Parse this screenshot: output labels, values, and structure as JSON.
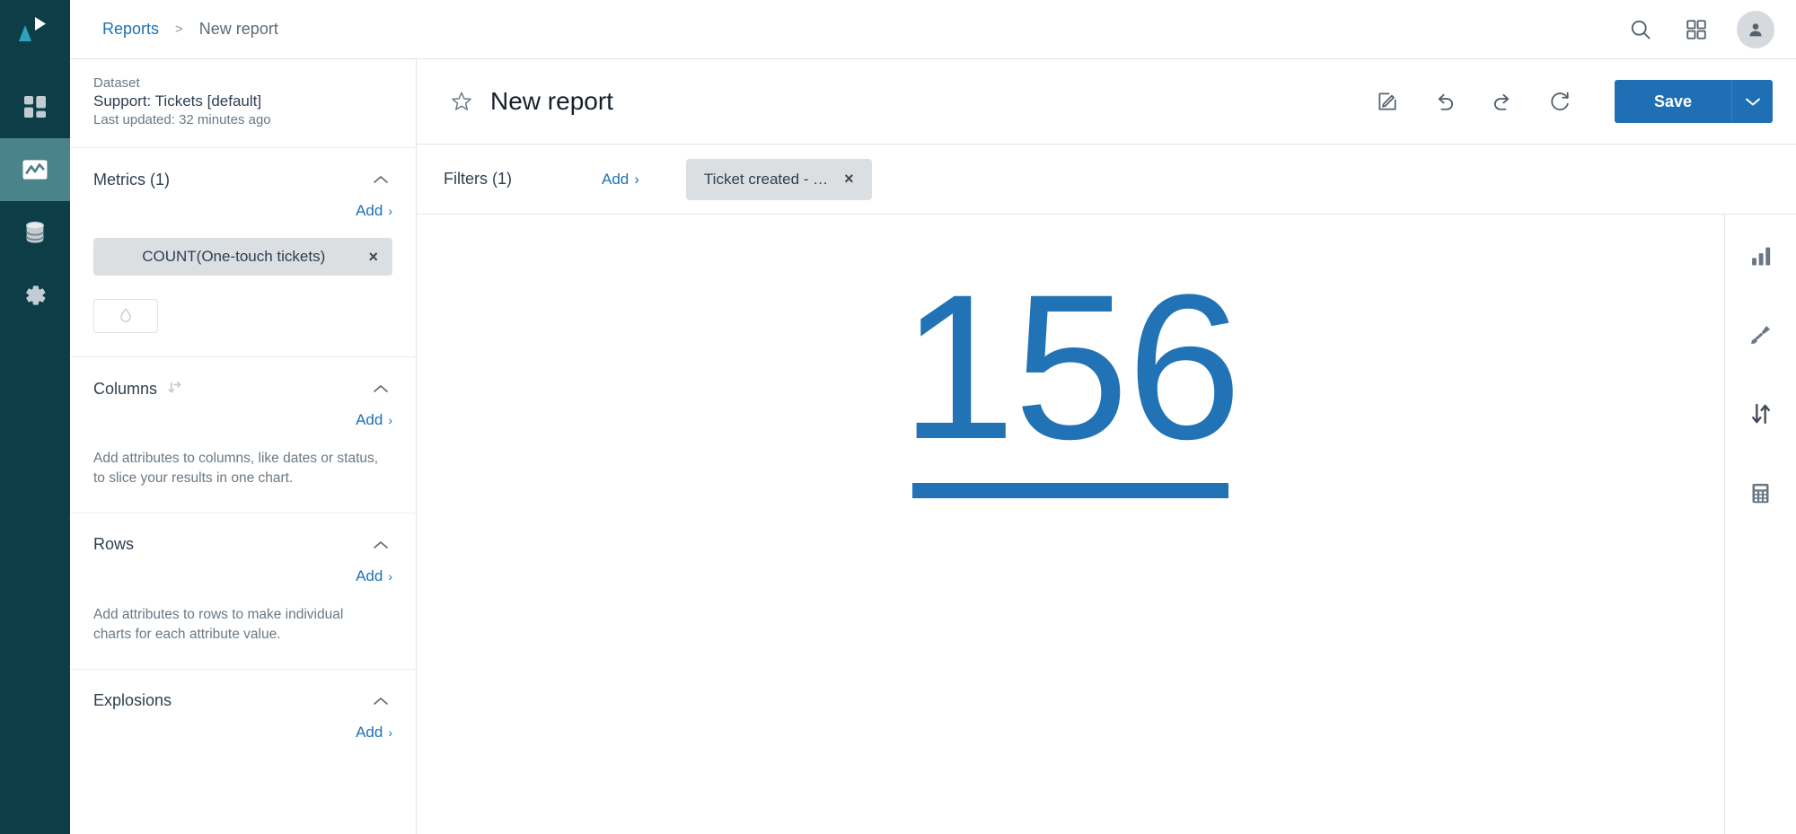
{
  "app": {
    "logo_name": "play-triangle-logo",
    "accent_blue": "#1f6fb5",
    "kpi_blue": "#2273b5",
    "rail_bg": "#0d3e47",
    "rail_active_bg": "#4a8389",
    "chip_bg": "#dcdfe2"
  },
  "rail": {
    "items": [
      {
        "icon": "dashboard-grid-icon",
        "name": "sidebar-item-dashboards",
        "active": false
      },
      {
        "icon": "line-chart-icon",
        "name": "sidebar-item-reports",
        "active": true
      },
      {
        "icon": "database-icon",
        "name": "sidebar-item-datasets",
        "active": false
      },
      {
        "icon": "gear-icon",
        "name": "sidebar-item-settings",
        "active": false
      }
    ]
  },
  "topbar": {
    "breadcrumb": {
      "root": "Reports",
      "separator": ">",
      "current": "New report"
    },
    "actions": [
      {
        "name": "search-icon",
        "label": "Search"
      },
      {
        "name": "apps-grid-icon",
        "label": "Apps"
      },
      {
        "name": "avatar",
        "label": "Account"
      }
    ]
  },
  "panel": {
    "dataset": {
      "label": "Dataset",
      "name": "Support: Tickets [default]",
      "updated": "Last updated: 32 minutes ago"
    },
    "sections": [
      {
        "key": "metrics",
        "title": "Metrics (1)",
        "add_label": "Add",
        "add_caret": "›",
        "chip": "COUNT(One-touch tickets)",
        "chip_close": "×",
        "hint": ""
      },
      {
        "key": "columns",
        "title": "Columns",
        "add_label": "Add",
        "add_caret": "›",
        "hint": "Add attributes to columns, like dates or status, to slice your results in one chart."
      },
      {
        "key": "rows",
        "title": "Rows",
        "add_label": "Add",
        "add_caret": "›",
        "hint": "Add attributes to rows to make individual charts for each attribute value."
      },
      {
        "key": "explosions",
        "title": "Explosions",
        "add_label": "Add",
        "add_caret": "›",
        "hint": ""
      }
    ]
  },
  "report": {
    "title": "New report",
    "star_state": "unstarred",
    "tools": [
      {
        "name": "edit-pencil-icon",
        "label": "Edit"
      },
      {
        "name": "undo-icon",
        "label": "Undo"
      },
      {
        "name": "redo-icon",
        "label": "Redo"
      },
      {
        "name": "refresh-icon",
        "label": "Refresh"
      }
    ],
    "save_label": "Save",
    "save_caret": "⌄"
  },
  "filters": {
    "label": "Filters (1)",
    "add_label": "Add",
    "add_caret": "›",
    "chips": [
      {
        "text": "Ticket created - …",
        "close": "×"
      }
    ]
  },
  "chart_data": {
    "type": "kpi",
    "title": "",
    "value": "156",
    "metric": "COUNT(One-touch tickets)",
    "color": "#2273b5"
  },
  "right_rail": {
    "items": [
      {
        "name": "bar-chart-icon",
        "label": "Chart type"
      },
      {
        "name": "paintbrush-icon",
        "label": "Formatting"
      },
      {
        "name": "sort-arrows-icon",
        "label": "Sort"
      },
      {
        "name": "calculator-icon",
        "label": "Calculations"
      }
    ]
  }
}
